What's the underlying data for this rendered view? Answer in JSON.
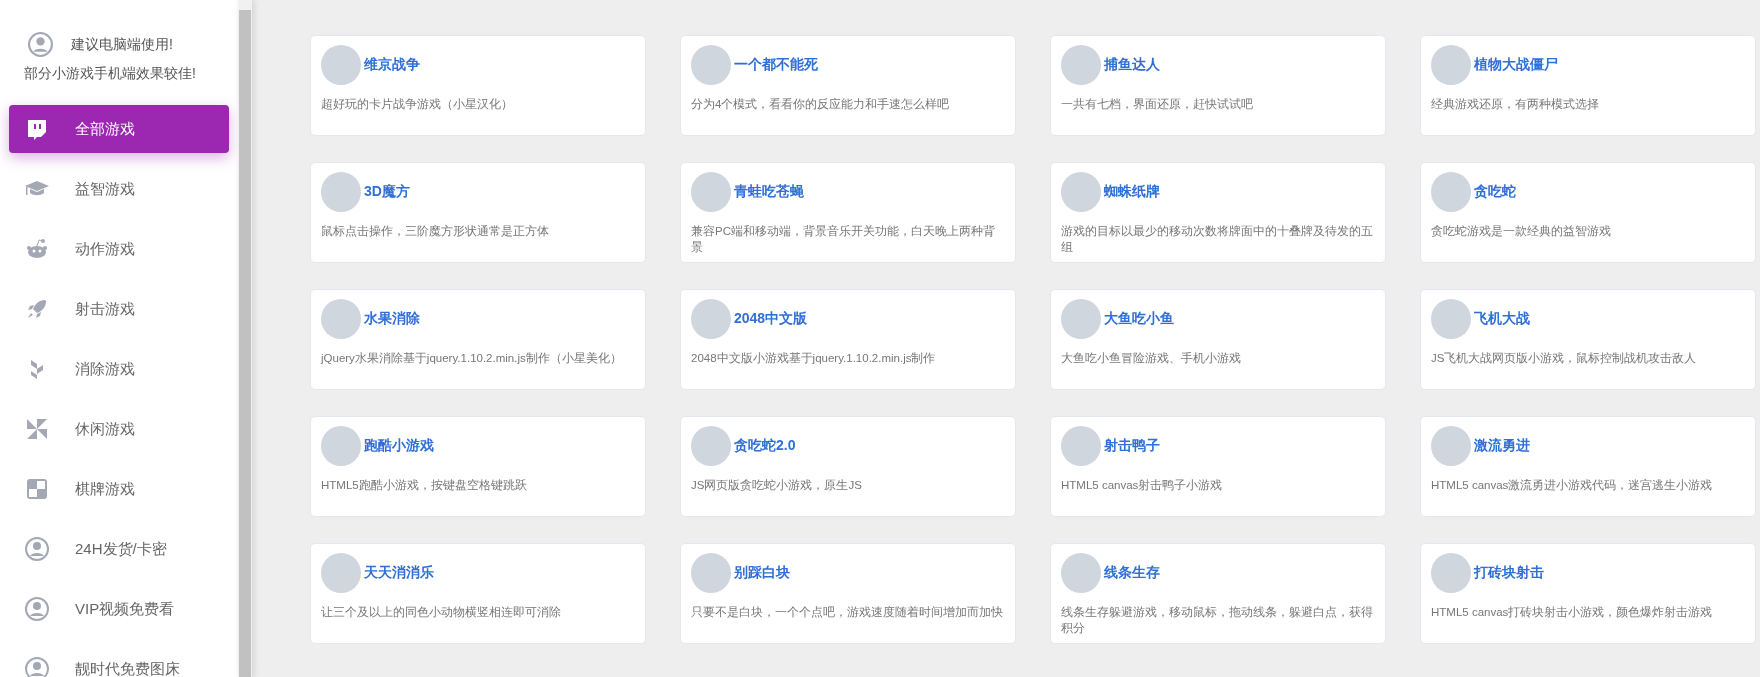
{
  "sidebar": {
    "notice": {
      "line_1": "建议电脑端使用!",
      "line_2": "部分小游戏手机端效果较佳!"
    },
    "items": [
      {
        "label": "全部游戏",
        "kind": "screen",
        "selected": true
      },
      {
        "label": "益智游戏",
        "kind": "cap",
        "selected": false
      },
      {
        "label": "动作游戏",
        "kind": "robot",
        "selected": false
      },
      {
        "label": "射击游戏",
        "kind": "rocket",
        "selected": false
      },
      {
        "label": "消除游戏",
        "kind": "blocks",
        "selected": false
      },
      {
        "label": "休闲游戏",
        "kind": "pinwheel",
        "selected": false
      },
      {
        "label": "棋牌游戏",
        "kind": "checker",
        "selected": false
      },
      {
        "label": "24H发货/卡密",
        "kind": "user",
        "selected": false
      },
      {
        "label": "VIP视频免费看",
        "kind": "user",
        "selected": false
      },
      {
        "label": "靓时代免费图床",
        "kind": "user",
        "selected": false
      }
    ]
  },
  "games": [
    {
      "title": "维京战争",
      "description": "超好玩的卡片战争游戏（小星汉化）"
    },
    {
      "title": "一个都不能死",
      "description": "分为4个模式，看看你的反应能力和手速怎么样吧"
    },
    {
      "title": "捕鱼达人",
      "description": "一共有七档，界面还原，赶快试试吧"
    },
    {
      "title": "植物大战僵尸",
      "description": "经典游戏还原，有两种模式选择"
    },
    {
      "title": "3D魔方",
      "description": "鼠标点击操作，三阶魔方形状通常是正方体"
    },
    {
      "title": "青蛙吃苍蝇",
      "description": "兼容PC端和移动端，背景音乐开关功能，白天晚上两种背景"
    },
    {
      "title": "蜘蛛纸牌",
      "description": "游戏的目标以最少的移动次数将牌面中的十叠牌及待发的五组"
    },
    {
      "title": "贪吃蛇",
      "description": "贪吃蛇游戏是一款经典的益智游戏"
    },
    {
      "title": "水果消除",
      "description": "jQuery水果消除基于jquery.1.10.2.min.js制作（小星美化）"
    },
    {
      "title": "2048中文版",
      "description": "2048中文版小游戏基于jquery.1.10.2.min.js制作"
    },
    {
      "title": "大鱼吃小鱼",
      "description": "大鱼吃小鱼冒险游戏、手机小游戏"
    },
    {
      "title": "飞机大战",
      "description": "JS飞机大战网页版小游戏，鼠标控制战机攻击敌人"
    },
    {
      "title": "跑酷小游戏",
      "description": "HTML5跑酷小游戏，按键盘空格键跳跃"
    },
    {
      "title": "贪吃蛇2.0",
      "description": "JS网页版贪吃蛇小游戏，原生JS"
    },
    {
      "title": "射击鸭子",
      "description": "HTML5 canvas射击鸭子小游戏"
    },
    {
      "title": "激流勇进",
      "description": "HTML5 canvas激流勇进小游戏代码，迷宫逃生小游戏"
    },
    {
      "title": "天天消消乐",
      "description": "让三个及以上的同色小动物横竖相连即可消除"
    },
    {
      "title": "别踩白块",
      "description": "只要不是白块，一个个点吧，游戏速度随着时间增加而加快"
    },
    {
      "title": "线条生存",
      "description": "线条生存躲避游戏，移动鼠标，拖动线条，躲避白点，获得积分"
    },
    {
      "title": "打砖块射击",
      "description": "HTML5 canvas打砖块射击小游戏，颜色爆炸射击游戏"
    }
  ]
}
